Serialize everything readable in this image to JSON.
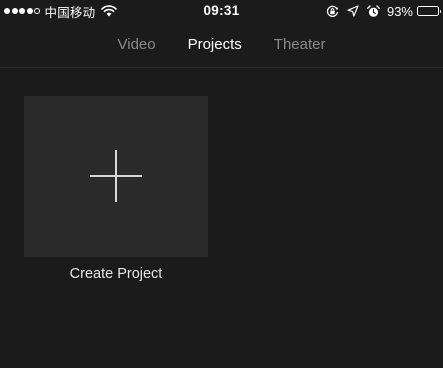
{
  "status_bar": {
    "signal_filled": 4,
    "signal_total": 5,
    "carrier": "中国移动",
    "time": "09:31",
    "battery_percent": "93%",
    "battery_level": 0.93,
    "icons": [
      "wifi-icon",
      "orientation-lock-icon",
      "location-icon",
      "alarm-icon",
      "battery-icon"
    ]
  },
  "tabs": [
    {
      "label": "Video",
      "active": false
    },
    {
      "label": "Projects",
      "active": true
    },
    {
      "label": "Theater",
      "active": false
    }
  ],
  "create_project": {
    "label": "Create Project",
    "icon": "plus-icon"
  },
  "colors": {
    "background": "#1b1b1b",
    "tile": "#2a2a2a",
    "tab_inactive": "#8a8a8a",
    "tab_active": "#ffffff"
  }
}
